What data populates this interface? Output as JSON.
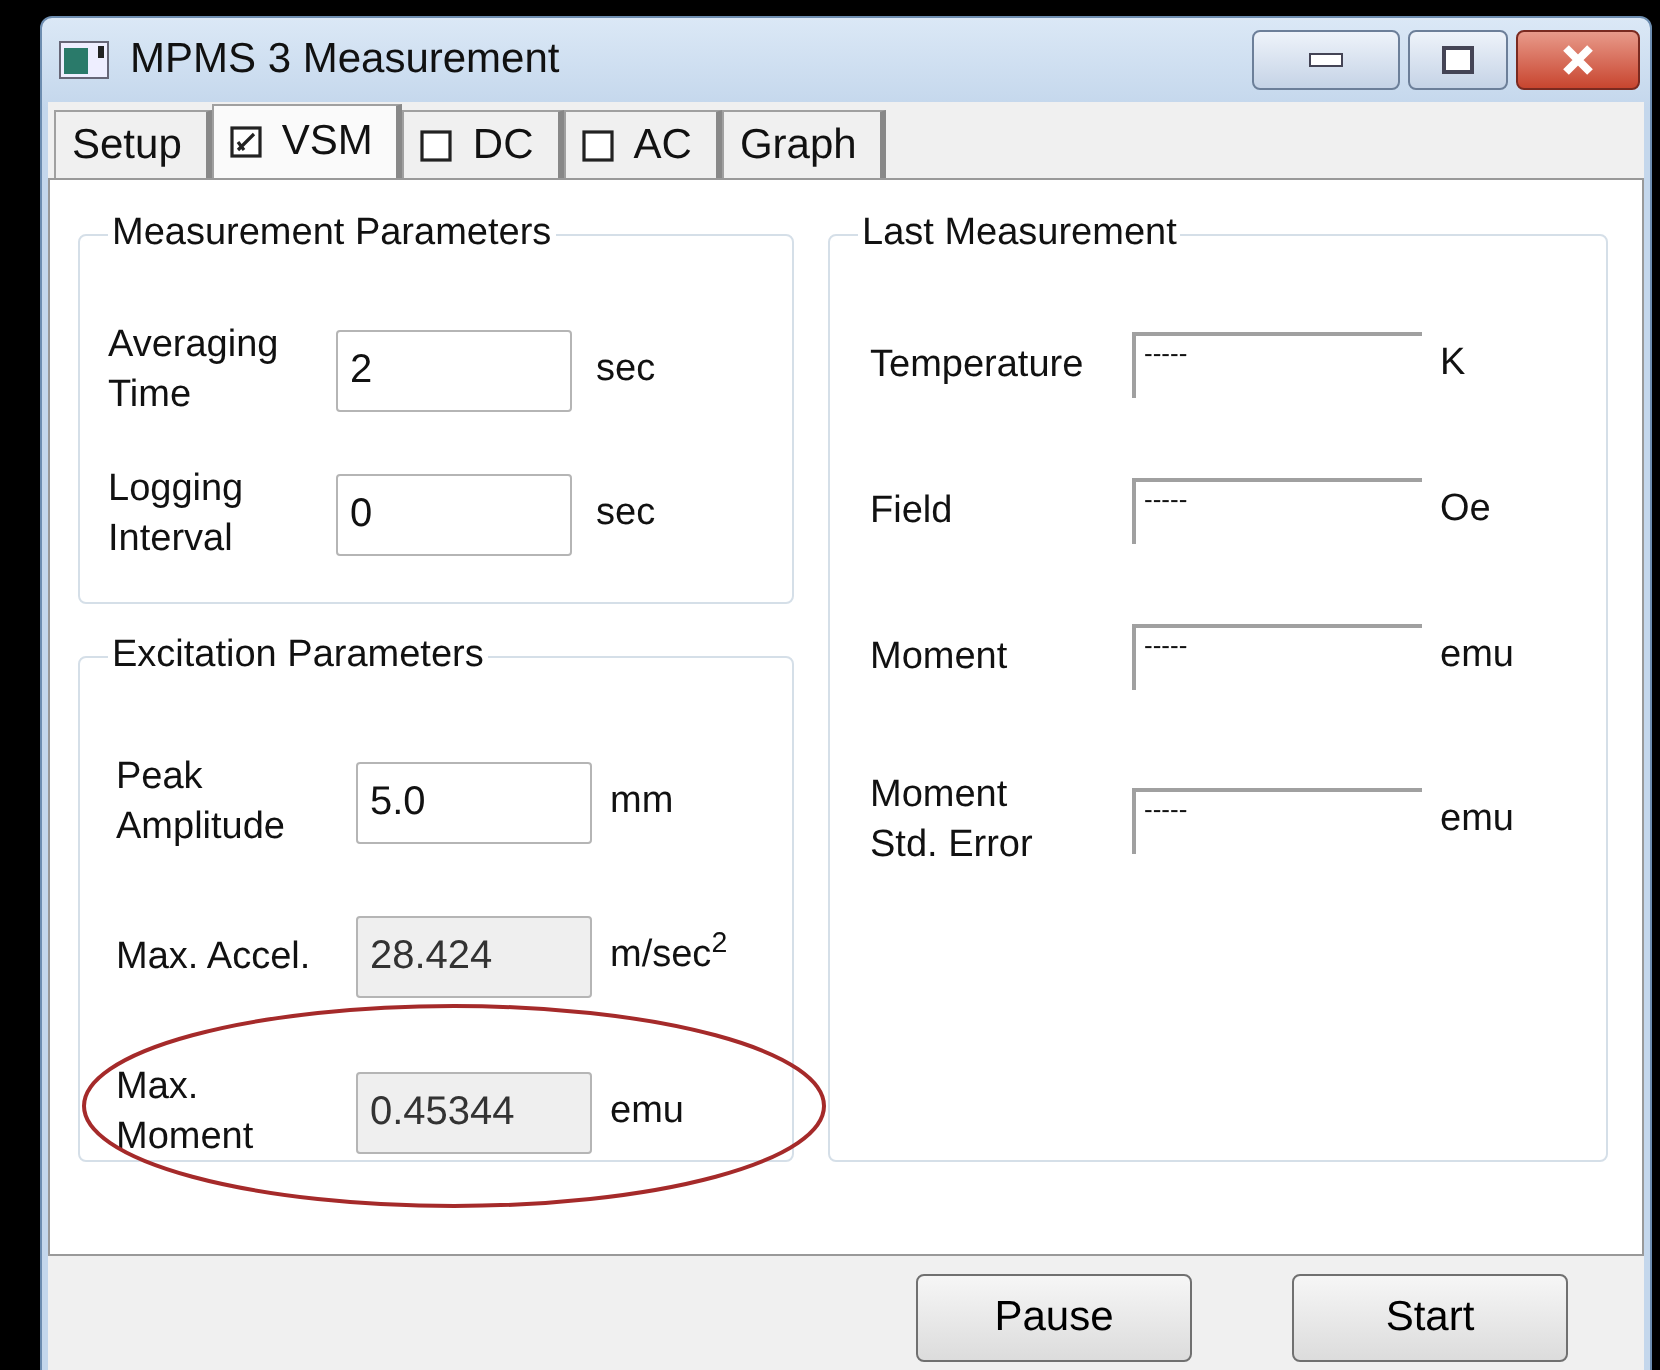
{
  "window": {
    "title": "MPMS 3 Measurement"
  },
  "tabs": [
    {
      "label": "Setup",
      "kind": "plain",
      "selected": false
    },
    {
      "label": "VSM",
      "kind": "checkbox",
      "checked": true,
      "selected": true
    },
    {
      "label": "DC",
      "kind": "checkbox",
      "checked": false,
      "selected": false
    },
    {
      "label": "AC",
      "kind": "checkbox",
      "checked": false,
      "selected": false
    },
    {
      "label": "Graph",
      "kind": "plain",
      "selected": false
    }
  ],
  "measurement_parameters": {
    "title": "Measurement Parameters",
    "rows": [
      {
        "label": "Averaging\nTime",
        "value": "2",
        "unit": "sec",
        "disabled": false
      },
      {
        "label": "Logging\nInterval",
        "value": "0",
        "unit": "sec",
        "disabled": false
      }
    ]
  },
  "excitation_parameters": {
    "title": "Excitation Parameters",
    "rows": [
      {
        "label": "Peak\nAmplitude",
        "value": "5.0",
        "unit": "mm",
        "disabled": false,
        "highlighted": false
      },
      {
        "label": "Max. Accel.",
        "value": "28.424",
        "unit": "m/sec$^{2}$",
        "disabled": true,
        "highlighted": false
      },
      {
        "label": "Max.\nMoment",
        "value": "0.45344",
        "unit": "emu",
        "disabled": true,
        "highlighted": true
      }
    ]
  },
  "last_measurement": {
    "title": "Last Measurement",
    "rows": [
      {
        "label": "Temperature",
        "value": "-----",
        "unit": "K"
      },
      {
        "label": "Field",
        "value": "-----",
        "unit": "Oe"
      },
      {
        "label": "Moment",
        "value": "-----",
        "unit": "emu"
      },
      {
        "label": "Moment\nStd. Error",
        "value": "-----",
        "unit": "emu"
      }
    ]
  },
  "buttons": [
    "Pause",
    "Start"
  ]
}
